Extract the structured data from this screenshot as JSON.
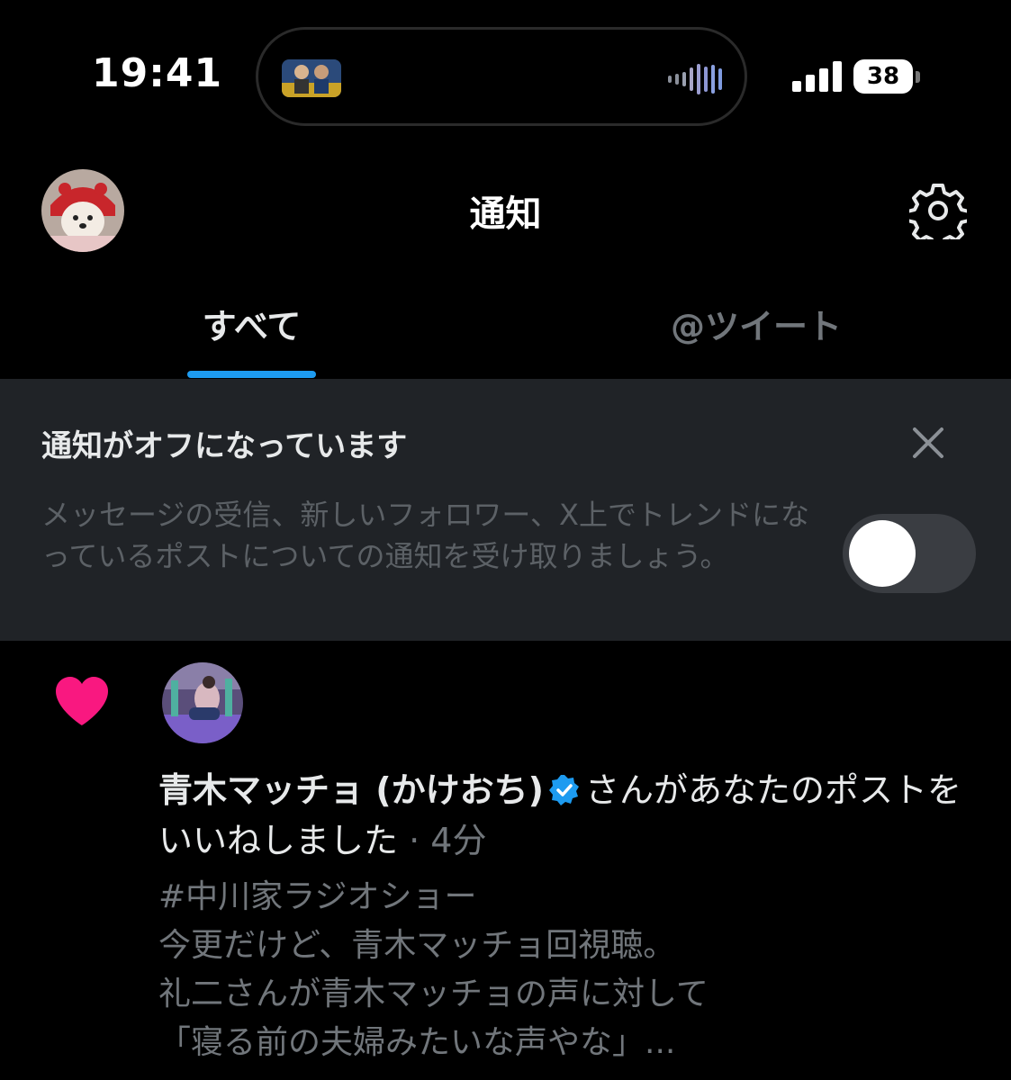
{
  "status_bar": {
    "time": "19:41",
    "battery": "38"
  },
  "header": {
    "title": "通知"
  },
  "tabs": [
    {
      "label": "すべて",
      "active": true
    },
    {
      "label": "@ツイート",
      "active": false
    }
  ],
  "banner": {
    "title": "通知がオフになっています",
    "description": "メッセージの受信、新しいフォロワー、X上でトレンドになっているポストについての通知を受け取りましょう。",
    "toggle_on": false
  },
  "notification": {
    "user_name": "青木マッチョ (かけおち)",
    "action": "さんがあなたのポストをいいねしました",
    "separator": " · ",
    "time": "4分",
    "tweet_lines": [
      "#中川家ラジオショー",
      "今更だけど、青木マッチョ回視聴。",
      "礼二さんが青木マッチョの声に対して",
      "「寝る前の夫婦みたいな声やな」..."
    ]
  },
  "colors": {
    "accent": "#1d9bf0",
    "like": "#f91880",
    "background": "#000000",
    "banner_bg": "#202327",
    "muted_text": "#71767b"
  },
  "icons": [
    "settings-gear-icon",
    "close-icon",
    "heart-icon",
    "verified-badge-icon",
    "signal-icon",
    "battery-icon"
  ]
}
